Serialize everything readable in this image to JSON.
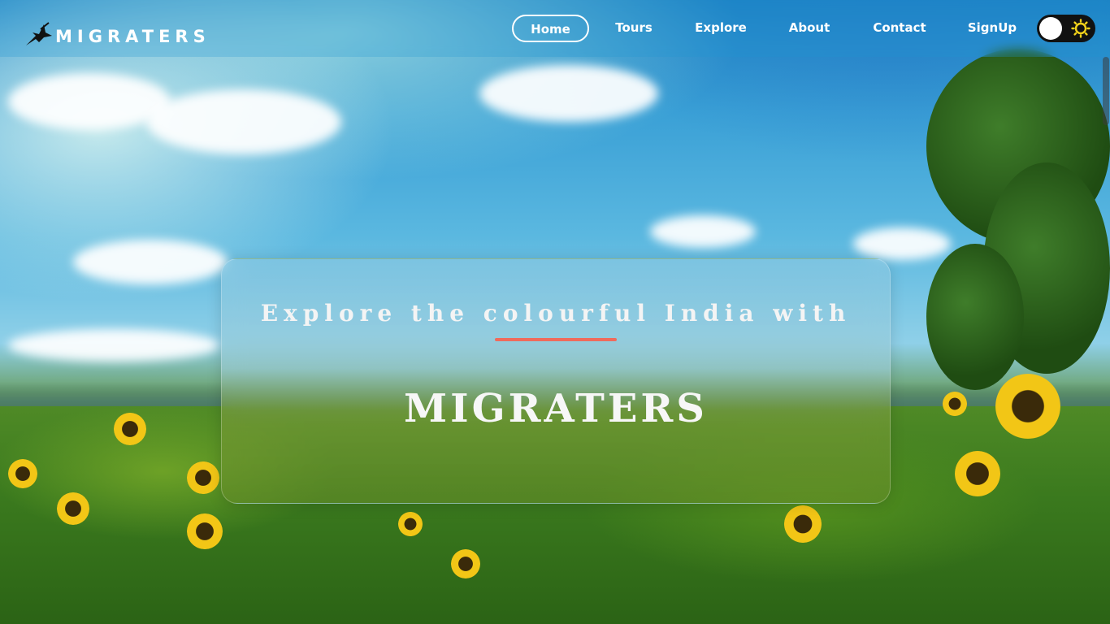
{
  "brand": {
    "name": "MIGRATERS",
    "logo_icon": "bird-icon"
  },
  "nav": {
    "items": [
      {
        "label": "Home",
        "active": true
      },
      {
        "label": "Tours",
        "active": false
      },
      {
        "label": "Explore",
        "active": false
      },
      {
        "label": "About",
        "active": false
      },
      {
        "label": "Contact",
        "active": false
      },
      {
        "label": "SignUp",
        "active": false
      }
    ]
  },
  "theme_toggle": {
    "icon": "sun-icon",
    "state": "light",
    "sun_color": "#f2d21b"
  },
  "hero": {
    "subtitle": "Explore the colourful India with",
    "title": "MIGRATERS",
    "underline_color": "#ef6b5c"
  }
}
